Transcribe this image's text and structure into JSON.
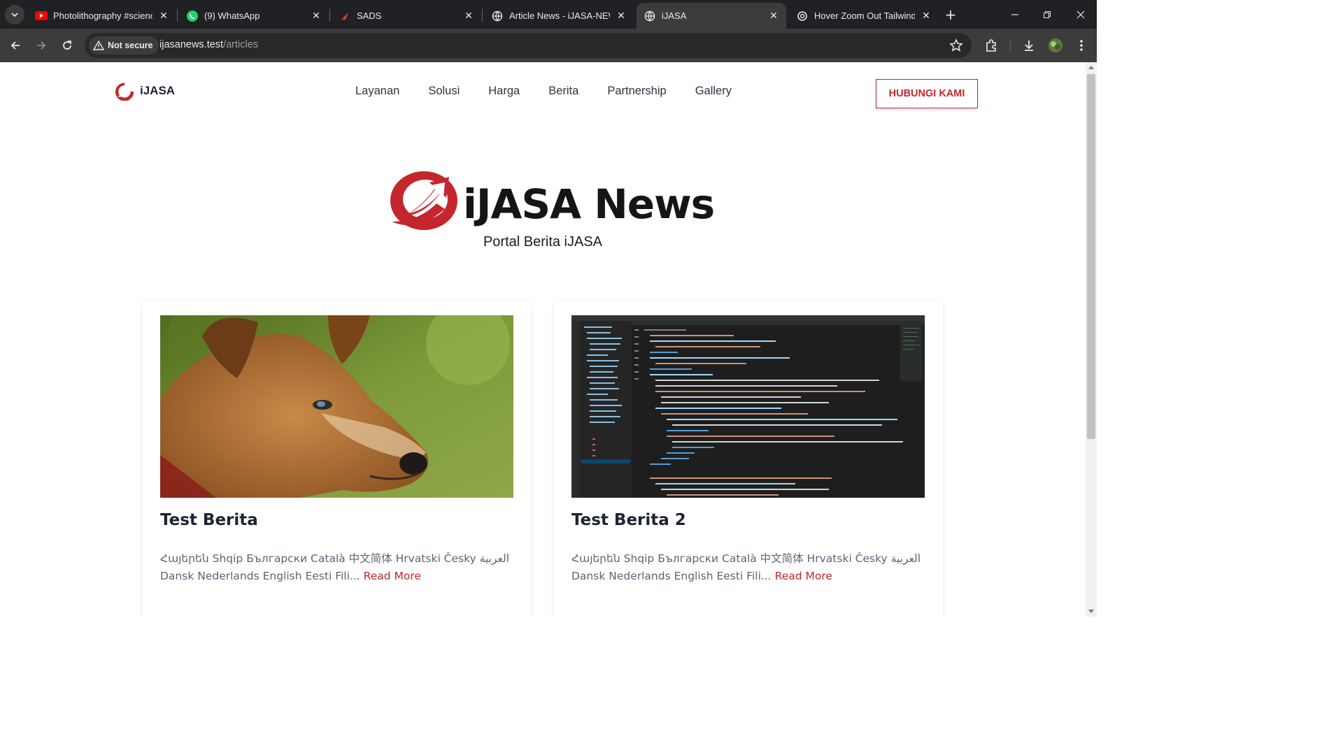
{
  "browser": {
    "tabs": [
      {
        "title": "Photolithography #science",
        "icon": "youtube-icon",
        "active": false
      },
      {
        "title": "(9) WhatsApp",
        "icon": "whatsapp-icon",
        "active": false
      },
      {
        "title": "SADS",
        "icon": "sads-icon",
        "active": false
      },
      {
        "title": "Article News - iJASA-NEWS",
        "icon": "globe-icon",
        "active": false
      },
      {
        "title": "iJASA",
        "icon": "globe-icon",
        "active": true
      },
      {
        "title": "Hover Zoom Out Tailwind",
        "icon": "openai-icon",
        "active": false
      }
    ],
    "security_label": "Not secure",
    "url_host": "ijasanews.test",
    "url_path": "/articles"
  },
  "site": {
    "brand": "iJASA",
    "nav": [
      "Layanan",
      "Solusi",
      "Harga",
      "Berita",
      "Partnership",
      "Gallery"
    ],
    "cta": "HUBUNGI KAMI",
    "hero_title": "iJASA News",
    "hero_subtitle": "Portal Berita iJASA",
    "accent_color": "#c3272d"
  },
  "articles": [
    {
      "title": "Test Berita",
      "excerpt": "Հայերեն Shqip Български Català 中文简体 Hrvatski Česky العربية Dansk Nederlands English Eesti Fili...",
      "read_more": "Read More",
      "image": "dog-photo"
    },
    {
      "title": "Test Berita 2",
      "excerpt": "Հայերեն Shqip Български Català 中文简体 Hrvatski Česky العربية Dansk Nederlands English Eesti Fili...",
      "read_more": "Read More",
      "image": "code-editor-screenshot"
    }
  ]
}
